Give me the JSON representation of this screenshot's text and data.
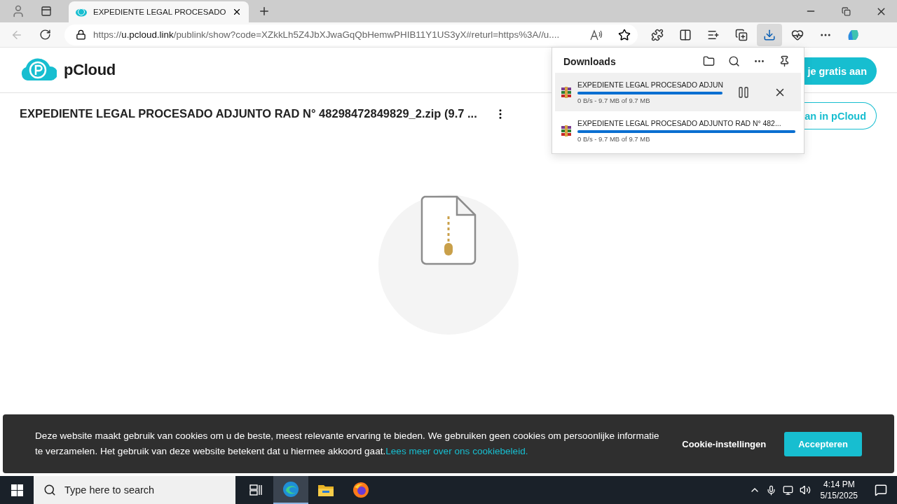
{
  "browser": {
    "tab": {
      "title": "EXPEDIENTE LEGAL PROCESADO",
      "selected": true
    },
    "url": {
      "scheme": "https://",
      "host": "u.pcloud.link",
      "path": "/publink/show?code=XZkkLh5Z4JbXJwaGqQbHemwPHIB11Y1US3yX#returl=https%3A//u...."
    }
  },
  "page": {
    "logo": "pCloud",
    "buttons": [
      {
        "label": "je gratis aan",
        "kind": "filled"
      },
      {
        "label": "an in pCloud",
        "kind": "outline"
      }
    ],
    "file_title": "EXPEDIENTE LEGAL PROCESADO ADJUNTO RAD N° 48298472849829_2.zip (9.7 ..."
  },
  "downloads": {
    "title": "Downloads",
    "items": [
      {
        "name": "EXPEDIENTE LEGAL PROCESADO ADJUN",
        "status": "0 B/s - 9.7 MB of 9.7 MB",
        "level": 1,
        "hovered": true
      },
      {
        "name": "EXPEDIENTE LEGAL PROCESADO ADJUNTO RAD N° 482...",
        "status": "0 B/s - 9.7 MB of 9.7 MB",
        "level": 1,
        "hovered": false
      }
    ]
  },
  "cookie_bar": {
    "text": "Deze website maakt gebruik van cookies om u de beste, meest relevante ervaring te bieden. We gebruiken geen cookies om persoonlijke informatie te verzamelen. Het gebruik van deze website betekent dat u hiermee akkoord gaat.",
    "link": "Lees meer over ons cookiebeleid.",
    "settings": "Cookie-instellingen",
    "accept": "Accepteren"
  },
  "taskbar": {
    "search_placeholder": "Type here to search",
    "time": "4:14 PM",
    "date": "5/15/2025"
  }
}
